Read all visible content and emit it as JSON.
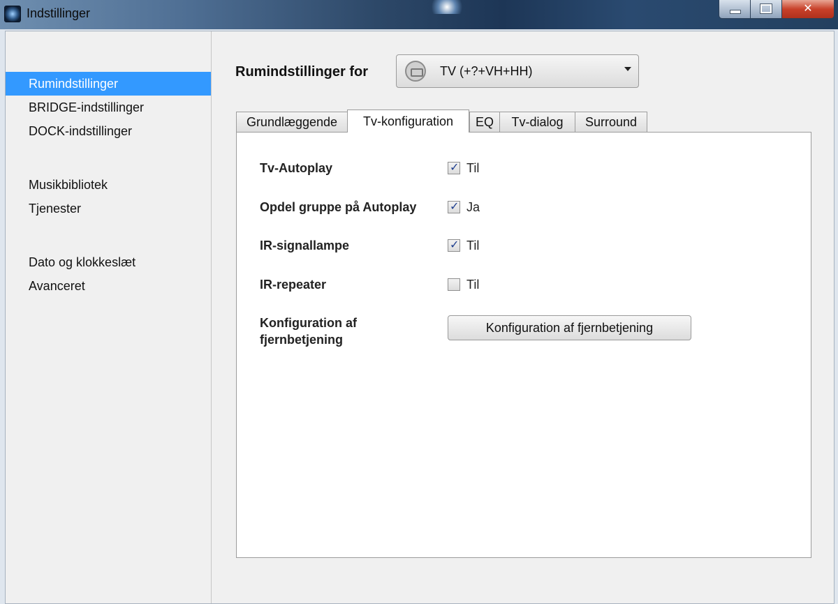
{
  "window": {
    "title": "Indstillinger",
    "controls": {
      "minimize": "minimize",
      "maximize": "maximize",
      "close": "✕"
    }
  },
  "sidebar": {
    "items": [
      {
        "label": "Rumindstillinger",
        "selected": true
      },
      {
        "label": "BRIDGE-indstillinger",
        "selected": false
      },
      {
        "label": "DOCK-indstillinger",
        "selected": false
      },
      {
        "label": "Musikbibliotek",
        "selected": false
      },
      {
        "label": "Tjenester",
        "selected": false
      },
      {
        "label": "Dato og klokkeslæt",
        "selected": false
      },
      {
        "label": "Avanceret",
        "selected": false
      }
    ]
  },
  "main": {
    "room_label": "Rumindstillinger for",
    "room_select": {
      "value": "TV (+?+VH+HH)",
      "icon": "tv-icon"
    },
    "tabs": [
      {
        "label": "Grundlæggende",
        "active": false
      },
      {
        "label": "Tv-konfiguration",
        "active": true
      },
      {
        "label": "EQ",
        "active": false
      },
      {
        "label": "Tv-dialog",
        "active": false
      },
      {
        "label": "Surround",
        "active": false
      }
    ],
    "settings": [
      {
        "label": "Tv-Autoplay",
        "checked": true,
        "option": "Til"
      },
      {
        "label": "Opdel gruppe på Autoplay",
        "checked": true,
        "option": "Ja"
      },
      {
        "label": "IR-signallampe",
        "checked": true,
        "option": "Til"
      },
      {
        "label": "IR-repeater",
        "checked": false,
        "option": "Til"
      }
    ],
    "remote": {
      "label_line1": "Konfiguration af",
      "label_line2": "fjernbetjening",
      "button": "Konfiguration af fjernbetjening"
    }
  },
  "colors": {
    "selection": "#3399ff",
    "checkmark": "#1f3f8f"
  }
}
